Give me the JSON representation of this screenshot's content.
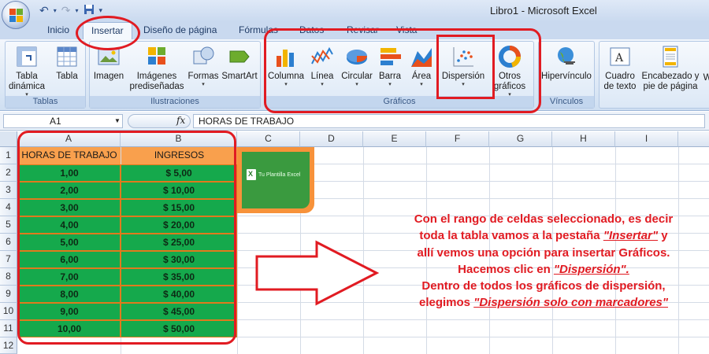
{
  "window": {
    "title": "Libro1 - Microsoft Excel"
  },
  "tabs": [
    "Inicio",
    "Insertar",
    "Diseño de página",
    "Fórmulas",
    "Datos",
    "Revisar",
    "Vista"
  ],
  "active_tab": "Insertar",
  "ribbon": {
    "tablas": {
      "label": "Tablas",
      "buttons": [
        "Tabla dinámica",
        "Tabla"
      ]
    },
    "ilustraciones": {
      "label": "Ilustraciones",
      "buttons": [
        "Imagen",
        "Imágenes prediseñadas",
        "Formas",
        "SmartArt"
      ]
    },
    "graficos": {
      "label": "Gráficos",
      "buttons": [
        "Columna",
        "Línea",
        "Circular",
        "Barra",
        "Área",
        "Dispersión",
        "Otros gráficos"
      ]
    },
    "vinculos": {
      "label": "Vínculos",
      "buttons": [
        "Hipervínculo"
      ]
    },
    "texto": {
      "buttons": [
        "Cuadro de texto",
        "Encabezado y pie de página",
        "W"
      ]
    }
  },
  "formula_bar": {
    "name_box": "A1",
    "fx": "fx",
    "value": "HORAS DE TRABAJO"
  },
  "columns": [
    "A",
    "B",
    "C",
    "D",
    "E",
    "F",
    "G",
    "H",
    "I"
  ],
  "rows": [
    "1",
    "2",
    "3",
    "4",
    "5",
    "6",
    "7",
    "8",
    "9",
    "10",
    "11",
    "12"
  ],
  "table": {
    "headers": [
      "HORAS DE TRABAJO",
      "INGRESOS"
    ],
    "data": [
      [
        "1,00",
        "$ 5,00"
      ],
      [
        "2,00",
        "$ 10,00"
      ],
      [
        "3,00",
        "$ 15,00"
      ],
      [
        "4,00",
        "$ 20,00"
      ],
      [
        "5,00",
        "$ 25,00"
      ],
      [
        "6,00",
        "$ 30,00"
      ],
      [
        "7,00",
        "$ 35,00"
      ],
      [
        "8,00",
        "$ 40,00"
      ],
      [
        "9,00",
        "$ 45,00"
      ],
      [
        "10,00",
        "$ 50,00"
      ]
    ]
  },
  "thumbnail_text": "Tu Plantilla Excel",
  "annotation": {
    "l1": "Con el rango de celdas seleccionado, es decir",
    "l2a": "toda la tabla vamos a la pestaña ",
    "l2b": "\"Insertar\"",
    "l2c": " y",
    "l3": "allí vemos una opción para insertar Gráficos.",
    "l4a": "Hacemos clic en ",
    "l4b": "\"Dispersión\".",
    "l5": "Dentro de todos los gráficos de dispersión,",
    "l6a": "elegimos ",
    "l6b": "\"Dispersión solo con marcadores\""
  },
  "colors": {
    "header_fill": "#f9a04d",
    "data_fill": "#15a94c",
    "annotation": "#e11b22"
  }
}
